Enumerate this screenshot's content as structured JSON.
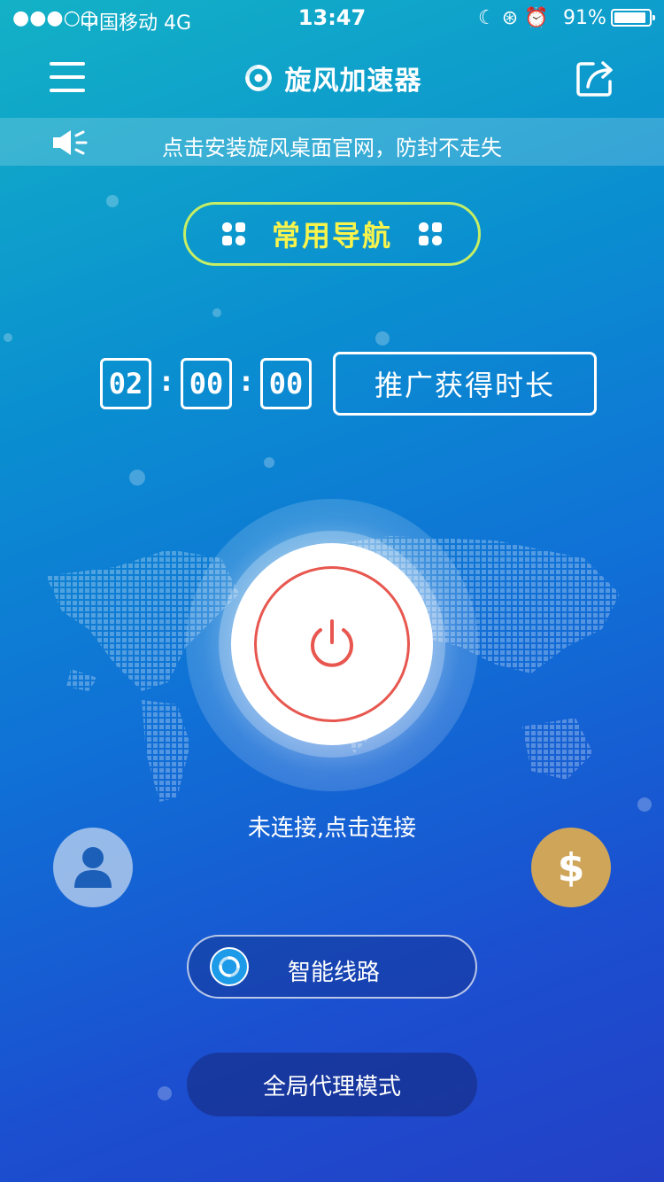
{
  "status_bar": {
    "signal": "●●●○○",
    "carrier": "中国移动   4G",
    "time": "13:47",
    "icons": "☾  ⊛  ⏰",
    "battery_percent": "91%",
    "battery_level": 0.91
  },
  "header": {
    "title": "旋风加速器",
    "menu_icon": "hamburger-menu-icon",
    "share_icon": "share-icon"
  },
  "notice": {
    "text": "点击安装旋风桌面官网，防封不走失",
    "icon": "speaker-icon"
  },
  "nav_pill": {
    "label": "常用导航"
  },
  "timer": {
    "hours": "02",
    "minutes": "00",
    "seconds": "00",
    "promo_label": "推广获得时长"
  },
  "power": {
    "status_text": "未连接,点击连接"
  },
  "route": {
    "label": "智能线路"
  },
  "mode": {
    "label": "全局代理模式"
  },
  "colors": {
    "nav_pill_border": "#c6ee65",
    "nav_pill_text": "#f8f44b",
    "power_red": "#e7574f",
    "coin_gold": "#cfa55a"
  }
}
